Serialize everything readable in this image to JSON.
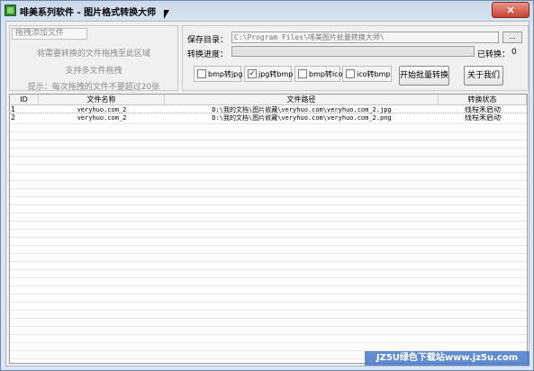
{
  "window": {
    "title": "啡美系列软件 - 图片格式转换大师",
    "close_label": "×"
  },
  "drag_panel": {
    "title": "拖拽添加文件",
    "hint_1": "将需要转换的文件拖拽至此区域",
    "hint_2": "支持多文件拖拽",
    "hint_3": "提示：每次拖拽的文件不要超过20张"
  },
  "settings": {
    "save_dir_label": "保存目录：",
    "save_dir_value": "C:\\Program Files\\啡美图片批量转换大师\\",
    "browse_label": "...",
    "progress_label": "转换进度：",
    "progress_fraction": 0,
    "converted_label": "已转换：",
    "converted_count": "0"
  },
  "options": [
    {
      "label": "bmp转jpg",
      "checked": false,
      "mark": ""
    },
    {
      "label": "jpg转bmp",
      "checked": true,
      "mark": "✓"
    },
    {
      "label": "bmp转ico",
      "checked": false,
      "mark": ""
    },
    {
      "label": "ico转bmp",
      "checked": false,
      "mark": ""
    }
  ],
  "buttons": {
    "start": "开始批量转换",
    "about": "关于我们"
  },
  "table": {
    "headers": {
      "id": "ID",
      "name": "文件名称",
      "path": "文件路径",
      "status": "转换状态"
    },
    "rows": [
      {
        "id": "1",
        "name": "veryhuo.com_2",
        "path": "D:\\我的文档\\图片收藏\\veryhuo.com\\veryhuo.com_2.jpg",
        "status": "线程未启动"
      },
      {
        "id": "2",
        "name": "veryhuo.com_2",
        "path": "D:\\我的文档\\图片收藏\\veryhuo.com\\veryhuo.com_2.png",
        "status": "线程未启动"
      }
    ]
  },
  "watermark": "JZ5U绿色下载站www.jz5u.com"
}
